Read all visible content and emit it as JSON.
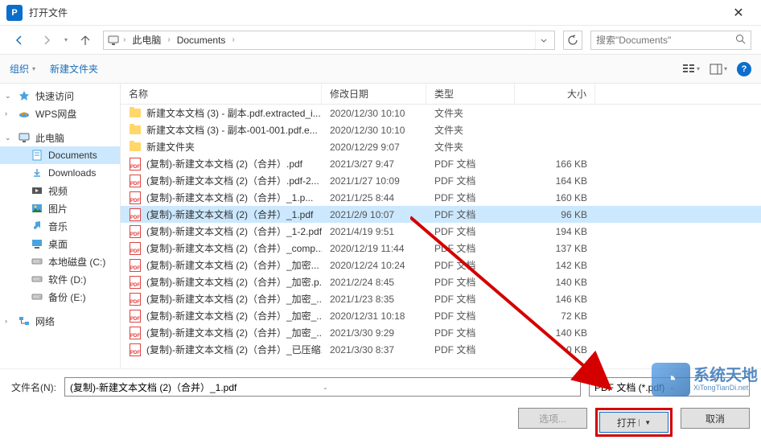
{
  "title": "打开文件",
  "breadcrumb": {
    "root": "此电脑",
    "folder": "Documents"
  },
  "search": {
    "placeholder": "搜索\"Documents\""
  },
  "toolbar": {
    "organize": "组织",
    "new_folder": "新建文件夹"
  },
  "columns": {
    "name": "名称",
    "date": "修改日期",
    "type": "类型",
    "size": "大小"
  },
  "sidebar": [
    {
      "icon": "star",
      "label": "快速访问",
      "exp": true
    },
    {
      "icon": "wps",
      "label": "WPS网盘",
      "exp": false
    },
    {
      "icon": "pc",
      "label": "此电脑",
      "exp": true
    },
    {
      "icon": "doc",
      "label": "Documents",
      "child": true,
      "selected": true
    },
    {
      "icon": "dl",
      "label": "Downloads",
      "child": true
    },
    {
      "icon": "vid",
      "label": "视频",
      "child": true
    },
    {
      "icon": "pic",
      "label": "图片",
      "child": true
    },
    {
      "icon": "mus",
      "label": "音乐",
      "child": true
    },
    {
      "icon": "desk",
      "label": "桌面",
      "child": true
    },
    {
      "icon": "disk",
      "label": "本地磁盘 (C:)",
      "child": true
    },
    {
      "icon": "disk",
      "label": "软件 (D:)",
      "child": true
    },
    {
      "icon": "disk",
      "label": "备份 (E:)",
      "child": true
    },
    {
      "icon": "net",
      "label": "网络",
      "exp": false
    }
  ],
  "files": [
    {
      "icon": "folder",
      "name": "新建文本文档 (3) - 副本.pdf.extracted_i...",
      "date": "2020/12/30 10:10",
      "type": "文件夹",
      "size": ""
    },
    {
      "icon": "folder",
      "name": "新建文本文档 (3) - 副本-001-001.pdf.e...",
      "date": "2020/12/30 10:10",
      "type": "文件夹",
      "size": ""
    },
    {
      "icon": "folder",
      "name": "新建文件夹",
      "date": "2020/12/29 9:07",
      "type": "文件夹",
      "size": ""
    },
    {
      "icon": "pdf",
      "name": "(复制)-新建文本文档 (2)（合并）.pdf",
      "date": "2021/3/27 9:47",
      "type": "PDF 文档",
      "size": "166 KB"
    },
    {
      "icon": "pdf",
      "name": "(复制)-新建文本文档 (2)（合并）.pdf-2...",
      "date": "2021/1/27 10:09",
      "type": "PDF 文档",
      "size": "164 KB"
    },
    {
      "icon": "pdf",
      "name": "(复制)-新建文本文档 (2)（合并）_1.p...",
      "date": "2021/1/25 8:44",
      "type": "PDF 文档",
      "size": "160 KB"
    },
    {
      "icon": "pdf",
      "name": "(复制)-新建文本文档 (2)（合并）_1.pdf",
      "date": "2021/2/9 10:07",
      "type": "PDF 文档",
      "size": "96 KB",
      "selected": true
    },
    {
      "icon": "pdf",
      "name": "(复制)-新建文本文档 (2)（合并）_1-2.pdf",
      "date": "2021/4/19 9:51",
      "type": "PDF 文档",
      "size": "194 KB"
    },
    {
      "icon": "pdf",
      "name": "(复制)-新建文本文档 (2)（合并）_comp...",
      "date": "2020/12/19 11:44",
      "type": "PDF 文档",
      "size": "137 KB"
    },
    {
      "icon": "pdf",
      "name": "(复制)-新建文本文档 (2)（合并）_加密...",
      "date": "2020/12/24 10:24",
      "type": "PDF 文档",
      "size": "142 KB"
    },
    {
      "icon": "pdf",
      "name": "(复制)-新建文本文档 (2)（合并）_加密.p...",
      "date": "2021/2/24 8:45",
      "type": "PDF 文档",
      "size": "140 KB"
    },
    {
      "icon": "pdf",
      "name": "(复制)-新建文本文档 (2)（合并）_加密_...",
      "date": "2021/1/23 8:35",
      "type": "PDF 文档",
      "size": "146 KB"
    },
    {
      "icon": "pdf",
      "name": "(复制)-新建文本文档 (2)（合并）_加密_...",
      "date": "2020/12/31 10:18",
      "type": "PDF 文档",
      "size": "72 KB"
    },
    {
      "icon": "pdf",
      "name": "(复制)-新建文本文档 (2)（合并）_加密_...",
      "date": "2021/3/30 9:29",
      "type": "PDF 文档",
      "size": "140 KB"
    },
    {
      "icon": "pdf",
      "name": "(复制)-新建文本文档 (2)（合并）_已压缩...",
      "date": "2021/3/30 8:37",
      "type": "PDF 文档",
      "size": "0 KB"
    }
  ],
  "footer": {
    "filename_label": "文件名(N):",
    "filename_value": "(复制)-新建文本文档 (2)（合并）_1.pdf",
    "filetype": "PDF 文档 (*.pdf)",
    "options": "选项...",
    "open": "打开",
    "cancel": "取消"
  },
  "watermark": {
    "cn": "系统天地",
    "en": "XiTongTianDi.net"
  }
}
